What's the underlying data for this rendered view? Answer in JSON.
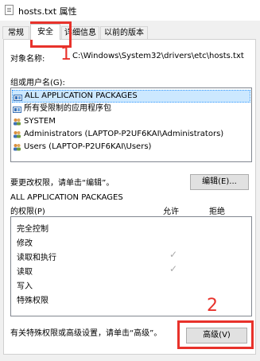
{
  "window": {
    "title": "hosts.txt 属性"
  },
  "tabs": [
    {
      "label": "常规"
    },
    {
      "label": "安全"
    },
    {
      "label": "详细信息"
    },
    {
      "label": "以前的版本"
    }
  ],
  "security": {
    "object_label": "对象名称:",
    "object_value": "C:\\Windows\\System32\\drivers\\etc\\hosts.txt",
    "group_label": "组或用户名(G):",
    "users": [
      {
        "name": "ALL APPLICATION PACKAGES"
      },
      {
        "name": "所有受限制的应用程序包"
      },
      {
        "name": "SYSTEM"
      },
      {
        "name": "Administrators (LAPTOP-P2UF6KAI\\Administrators)"
      },
      {
        "name": "Users (LAPTOP-P2UF6KAI\\Users)"
      }
    ],
    "change_hint": "要更改权限，请单击“编辑”。",
    "edit_button": "编辑(E)...",
    "perm_title_line1": "ALL APPLICATION PACKAGES",
    "perm_title_line2": "的权限(P)",
    "allow_label": "允许",
    "deny_label": "拒绝",
    "permissions": [
      {
        "name": "完全控制",
        "allow": false
      },
      {
        "name": "修改",
        "allow": false
      },
      {
        "name": "读取和执行",
        "allow": true
      },
      {
        "name": "读取",
        "allow": true
      },
      {
        "name": "写入",
        "allow": false
      },
      {
        "name": "特殊权限",
        "allow": false
      }
    ],
    "advanced_hint": "有关特殊权限或高级设置，请单击“高级”。",
    "advanced_button": "高级(V)"
  },
  "annotations": {
    "step1": "1",
    "step2": "2",
    "color": "#e8322b"
  },
  "icons": {
    "file": "file-icon",
    "package": "package-icon",
    "users": "users-icon"
  }
}
